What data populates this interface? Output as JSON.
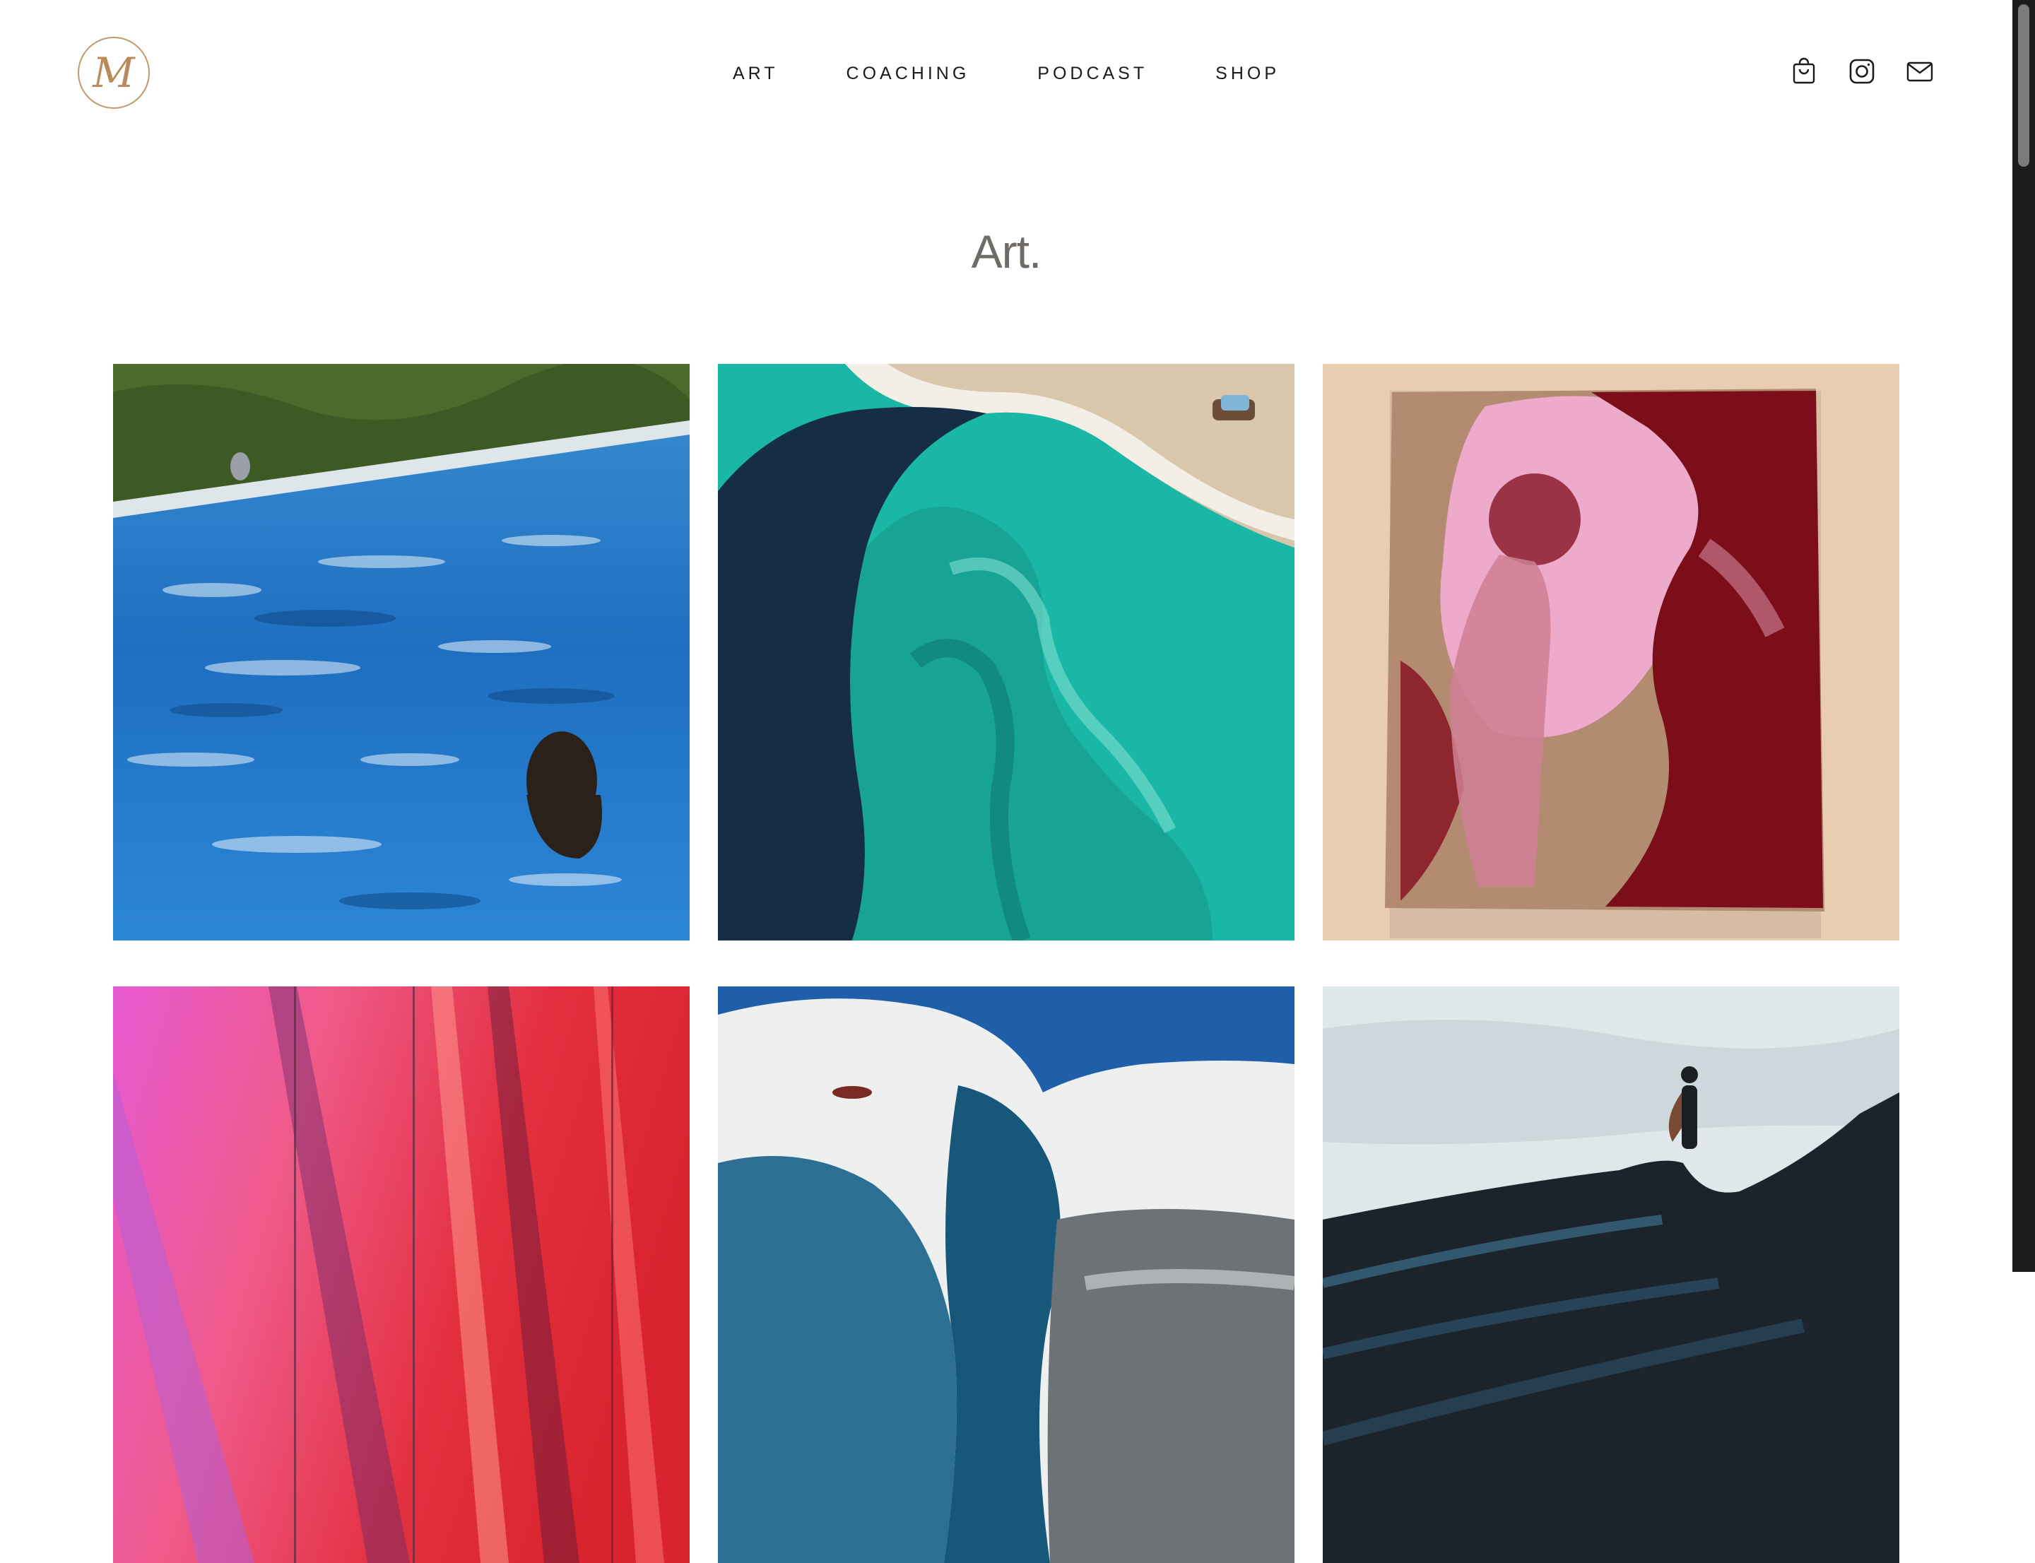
{
  "header": {
    "logo_text": "M",
    "nav": [
      {
        "label": "ART"
      },
      {
        "label": "COACHING"
      },
      {
        "label": "PODCAST"
      },
      {
        "label": "SHOP"
      }
    ],
    "icons": [
      "cart-icon",
      "instagram-icon",
      "mail-icon"
    ]
  },
  "main": {
    "title": "Art."
  },
  "gallery": [
    {
      "subject": "swimmer-in-pool"
    },
    {
      "subject": "turquoise-wave"
    },
    {
      "subject": "boy-figure-red-pink"
    },
    {
      "subject": "pink-red-abstract-triptych"
    },
    {
      "subject": "blue-white-rock-arch"
    },
    {
      "subject": "figure-on-dark-ridge"
    }
  ],
  "colors": {
    "accent_logo": "#c49a6c",
    "title_text": "#6f6b66",
    "nav_text": "#1a1a1a"
  }
}
